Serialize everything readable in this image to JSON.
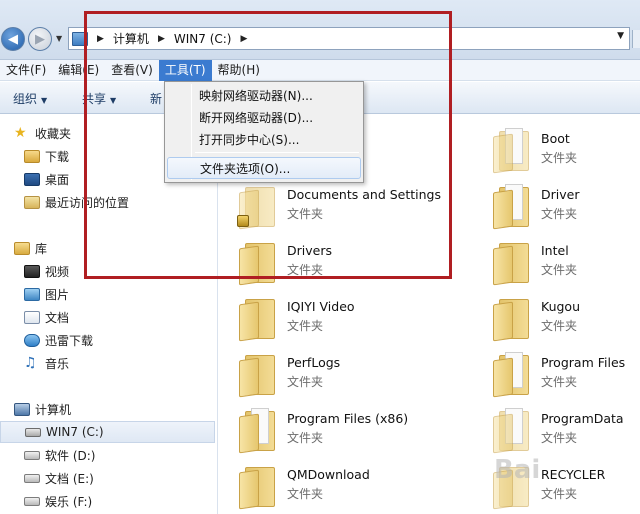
{
  "address": {
    "path": [
      "计算机",
      "WIN7 (C:)"
    ]
  },
  "menubar": {
    "items": [
      "文件(F)",
      "编辑(E)",
      "查看(V)",
      "工具(T)",
      "帮助(H)"
    ],
    "active_index": 3
  },
  "toolbar": {
    "organize_label": "组织",
    "share_label": "共享",
    "new_label": "新"
  },
  "tools_menu": {
    "items": [
      "映射网络驱动器(N)...",
      "断开网络驱动器(D)...",
      "打开同步中心(S)...",
      "文件夹选项(O)..."
    ],
    "highlighted": "文件夹选项(O)..."
  },
  "sidebar": {
    "favorites": {
      "label": "收藏夹",
      "items": [
        "下载",
        "桌面",
        "最近访问的位置"
      ]
    },
    "libraries": {
      "label": "库",
      "items": [
        "视频",
        "图片",
        "文档",
        "迅雷下载",
        "音乐"
      ]
    },
    "computer": {
      "label": "计算机",
      "items": [
        "WIN7 (C:)",
        "软件 (D:)",
        "文档 (E:)",
        "娱乐 (F:)"
      ],
      "selected": "WIN7 (C:)"
    }
  },
  "files": [
    {
      "name": "",
      "type": ""
    },
    {
      "name": "Boot",
      "type": "文件夹"
    },
    {
      "name": "Documents and Settings",
      "type": "文件夹"
    },
    {
      "name": "Driver",
      "type": "文件夹"
    },
    {
      "name": "Drivers",
      "type": "文件夹"
    },
    {
      "name": "Intel",
      "type": "文件夹"
    },
    {
      "name": "IQIYI Video",
      "type": "文件夹"
    },
    {
      "name": "Kugou",
      "type": "文件夹"
    },
    {
      "name": "PerfLogs",
      "type": "文件夹"
    },
    {
      "name": "Program Files",
      "type": "文件夹"
    },
    {
      "name": "Program Files (x86)",
      "type": "文件夹"
    },
    {
      "name": "ProgramData",
      "type": "文件夹"
    },
    {
      "name": "QMDownload",
      "type": "文件夹"
    },
    {
      "name": "RECYCLER",
      "type": "文件夹"
    }
  ],
  "watermark": "Bai"
}
